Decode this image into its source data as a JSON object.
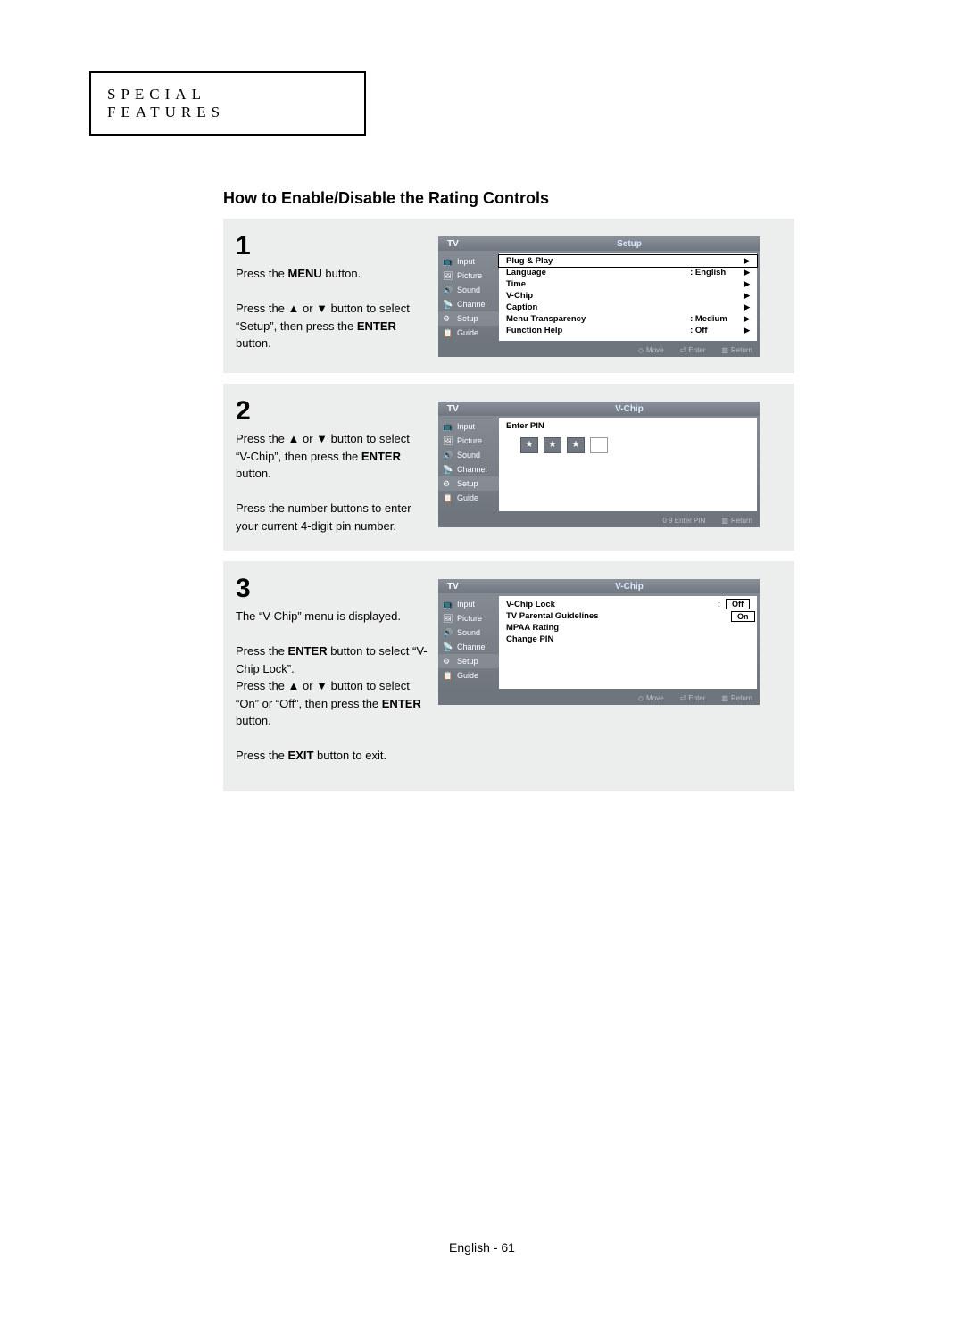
{
  "header": {
    "tab_label": "SPECIAL FEATURES"
  },
  "title": "How to Enable/Disable the Rating Controls",
  "sidebar": [
    "Input",
    "Picture",
    "Sound",
    "Channel",
    "Setup",
    "Guide"
  ],
  "steps": [
    {
      "num": "1",
      "text_pre": "Press the ",
      "text_b1": "MENU",
      "text_mid1": " button.",
      "br": true,
      "text2_pre": "Press the ▲ or ▼ button to select “Setup”, then press the ",
      "text2_b": "ENTER",
      "text2_post": " button.",
      "osd_title": "Setup",
      "rows": [
        {
          "label": "Plug & Play",
          "val": "",
          "sel": true
        },
        {
          "label": "Language",
          "val": ": English"
        },
        {
          "label": "Time",
          "val": ""
        },
        {
          "label": "V-Chip",
          "val": ""
        },
        {
          "label": "Caption",
          "val": ""
        },
        {
          "label": "Menu Transparency",
          "val": ": Medium"
        },
        {
          "label": "Function Help",
          "val": ": Off"
        }
      ],
      "footer": [
        "Move",
        "Enter",
        "Return"
      ]
    },
    {
      "num": "2",
      "text_pre": "Press the ▲ or ▼ button to select “V-Chip”, then press the ",
      "text_b1": "ENTER",
      "text_mid1": " button.",
      "br": true,
      "text2_pre": "Press the number buttons to enter your current 4-digit pin number.",
      "text2_b": "",
      "text2_post": "",
      "osd_title": "V-Chip",
      "pin_label": "Enter PIN",
      "footer": [
        "0 9 Enter PIN",
        "Return"
      ]
    },
    {
      "num": "3",
      "para1": "The “V-Chip” menu is displayed.",
      "para2_pre": "Press the ",
      "para2_b1": "ENTER",
      "para2_mid": " button to select “V-Chip Lock”.\nPress the ▲ or ▼ button to select “On” or “Off”, then press the ",
      "para2_b2": "ENTER",
      "para2_post": " button.",
      "para3_pre": "Press the ",
      "para3_b": "EXIT",
      "para3_post": " button to exit.",
      "osd_title": "V-Chip",
      "rows3": [
        {
          "label": "V-Chip Lock",
          "val": ":",
          "opt1": "Off",
          "opt2": "On"
        },
        {
          "label": "TV Parental Guidelines",
          "plain": true
        },
        {
          "label": "MPAA Rating",
          "plain": true
        },
        {
          "label": "Change PIN",
          "plain": true
        }
      ],
      "footer": [
        "Move",
        "Enter",
        "Return"
      ]
    }
  ],
  "page_footer": "English - 61"
}
